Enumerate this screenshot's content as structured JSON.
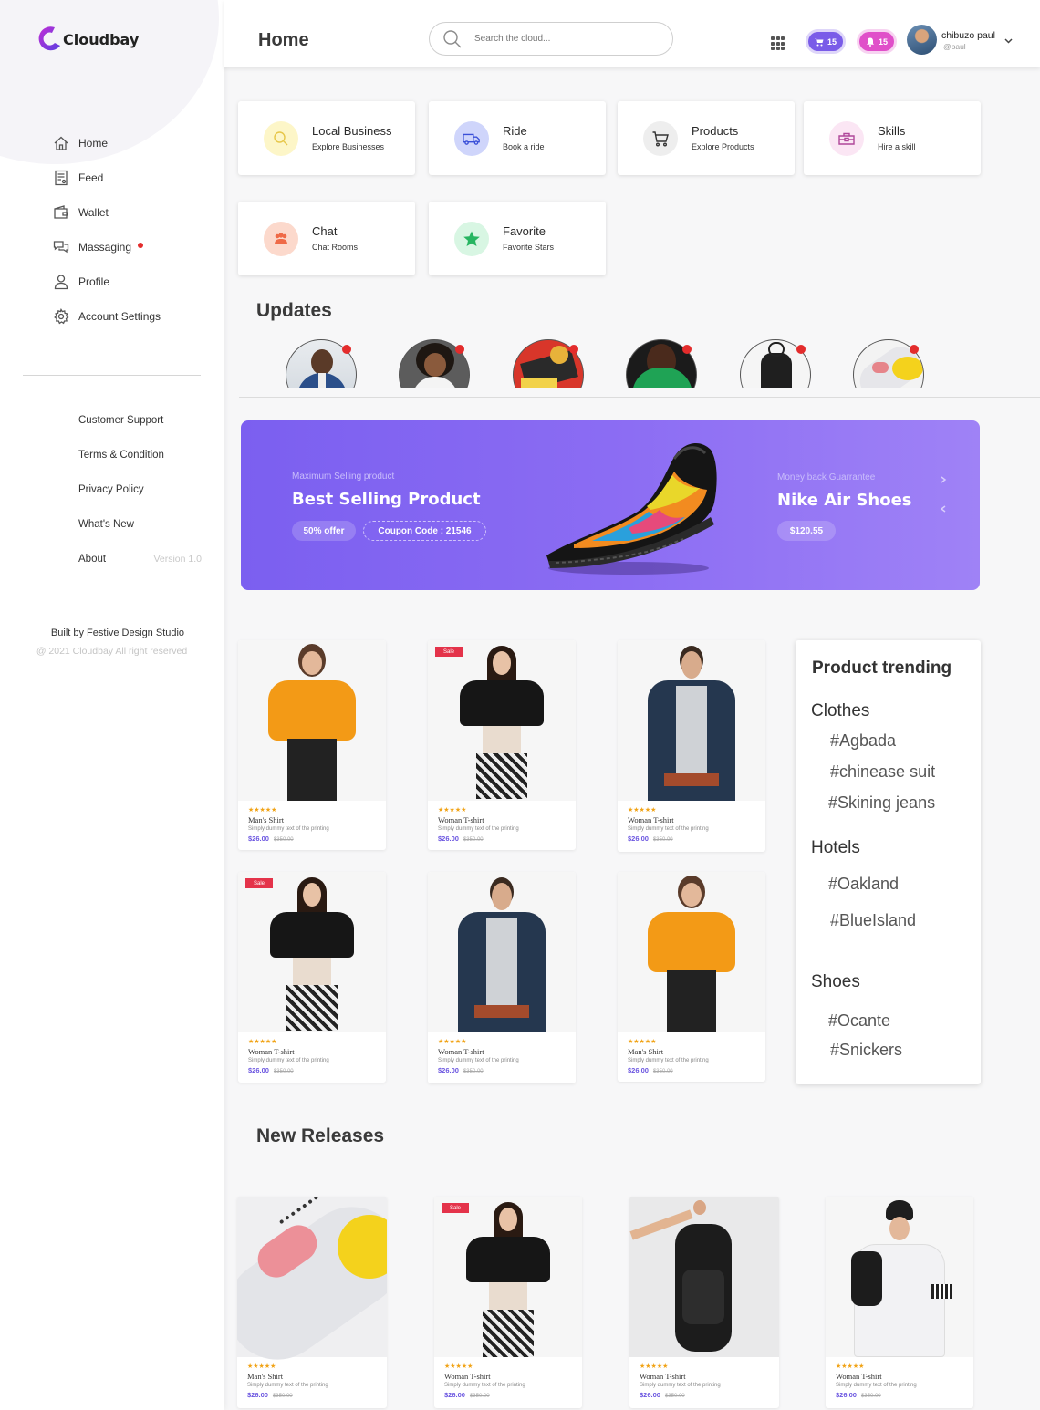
{
  "brand": {
    "name": "Cloudbay"
  },
  "sidebar": {
    "nav": [
      {
        "label": "Home",
        "icon": "home-icon"
      },
      {
        "label": "Feed",
        "icon": "feed-icon"
      },
      {
        "label": "Wallet",
        "icon": "wallet-icon"
      },
      {
        "label": "Massaging",
        "icon": "chat-icon",
        "unread": true
      },
      {
        "label": "Profile",
        "icon": "user-icon"
      },
      {
        "label": "Account Settings",
        "icon": "gear-icon"
      }
    ],
    "links": [
      "Customer Support",
      "Terms & Condition",
      "Privacy Policy",
      "What's New",
      "About"
    ],
    "version": "Version 1.0",
    "footer_built": "Built by Festive Design Studio",
    "footer_copy": "@ 2021 Cloudbay All right reserved"
  },
  "header": {
    "title": "Home",
    "search_placeholder": "Search the cloud...",
    "cart_count": "15",
    "notif_count": "15",
    "user_name": "chibuzo paul",
    "user_handle": "@paul"
  },
  "categories": [
    {
      "title": "Local Business",
      "subtitle": "Explore Businesses",
      "icon": "search-icon",
      "color": "#fdf6c8"
    },
    {
      "title": "Ride",
      "subtitle": "Book a ride",
      "icon": "truck-icon",
      "color": "#cfd5fb"
    },
    {
      "title": "Products",
      "subtitle": "Explore Products",
      "icon": "cart-icon",
      "color": "#eeeeee"
    },
    {
      "title": "Skills",
      "subtitle": "Hire a skill",
      "icon": "toolbox-icon",
      "color": "#fbe6f4"
    },
    {
      "title": "Chat",
      "subtitle": "Chat Rooms",
      "icon": "chat-group-icon",
      "color": "#fcd9cc"
    },
    {
      "title": "Favorite",
      "subtitle": "Favorite Stars",
      "icon": "star-icon",
      "color": "#d8f6e3"
    }
  ],
  "updates": {
    "title": "Updates"
  },
  "banner": {
    "left_small": "Maximum Selling product",
    "left_title": "Best Selling Product",
    "offer": "50% offer",
    "coupon": "Coupon Code : 21546",
    "right_small": "Money back Guarrantee",
    "right_title": "Nike Air Shoes",
    "price": "$120.55"
  },
  "products": [
    {
      "name": "Man's Shirt",
      "desc": "Simply dummy text of the printing",
      "price": "$26.00",
      "old": "$350.00",
      "sale": false
    },
    {
      "name": "Woman T-shirt",
      "desc": "Simply dummy text of the printing",
      "price": "$26.00",
      "old": "$350.00",
      "sale": true
    },
    {
      "name": "Woman T-shirt",
      "desc": "Simply dummy text of the printing",
      "price": "$26.00",
      "old": "$350.00",
      "sale": false
    },
    {
      "name": "Woman T-shirt",
      "desc": "Simply dummy text of the printing",
      "price": "$26.00",
      "old": "$350.00",
      "sale": true
    },
    {
      "name": "Woman T-shirt",
      "desc": "Simply dummy text of the printing",
      "price": "$26.00",
      "old": "$350.00",
      "sale": false
    },
    {
      "name": "Man's Shirt",
      "desc": "Simply dummy text of the printing",
      "price": "$26.00",
      "old": "$350.00",
      "sale": false
    }
  ],
  "trending": {
    "title": "Product trending",
    "groups": [
      {
        "name": "Clothes",
        "tags": [
          "#Agbada",
          "#chinease suit",
          "#Skining jeans"
        ]
      },
      {
        "name": "Hotels",
        "tags": [
          "#Oakland",
          "#BlueIsland"
        ]
      },
      {
        "name": "Shoes",
        "tags": [
          "#Ocante",
          "#Snickers"
        ]
      }
    ]
  },
  "releases": {
    "title": "New Releases",
    "items": [
      {
        "name": "Man's Shirt",
        "desc": "Simply dummy text of the printing",
        "price": "$26.00",
        "old": "$350.00",
        "sale": false
      },
      {
        "name": "Woman T-shirt",
        "desc": "Simply dummy text of the printing",
        "price": "$26.00",
        "old": "$350.00",
        "sale": true
      },
      {
        "name": "Woman T-shirt",
        "desc": "Simply dummy text of the printing",
        "price": "$26.00",
        "old": "$350.00",
        "sale": false
      },
      {
        "name": "Woman T-shirt",
        "desc": "Simply dummy text of the printing",
        "price": "$26.00",
        "old": "$350.00",
        "sale": false
      }
    ]
  },
  "sale_label": "Sale",
  "stars": "★★★★★"
}
